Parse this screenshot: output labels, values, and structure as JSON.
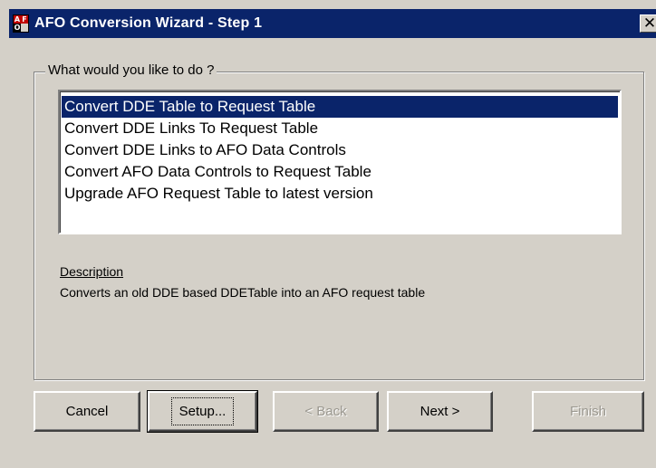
{
  "window": {
    "title": "AFO Conversion Wizard - Step 1",
    "close_glyph": "✕",
    "icon": "afo-app-icon",
    "icon_letters": [
      "A",
      "F",
      "O",
      ""
    ]
  },
  "group": {
    "label": "What would you like to do ?"
  },
  "options": {
    "selected_index": 0,
    "items": [
      "Convert DDE Table to Request Table",
      "Convert DDE Links To Request Table",
      "Convert DDE Links to AFO Data Controls",
      "Convert AFO Data Controls to Request Table",
      "Upgrade AFO Request Table to latest version"
    ]
  },
  "description": {
    "label": "Description",
    "text": "Converts an old DDE based DDETable into an AFO request table"
  },
  "buttons": {
    "cancel": "Cancel",
    "setup": "Setup...",
    "back": "< Back",
    "next": "Next >",
    "finish": "Finish"
  },
  "colors": {
    "face": "#d4d0c8",
    "title_bar": "#0a246a",
    "selection": "#0a246a",
    "disabled_text": "#9a978f"
  }
}
